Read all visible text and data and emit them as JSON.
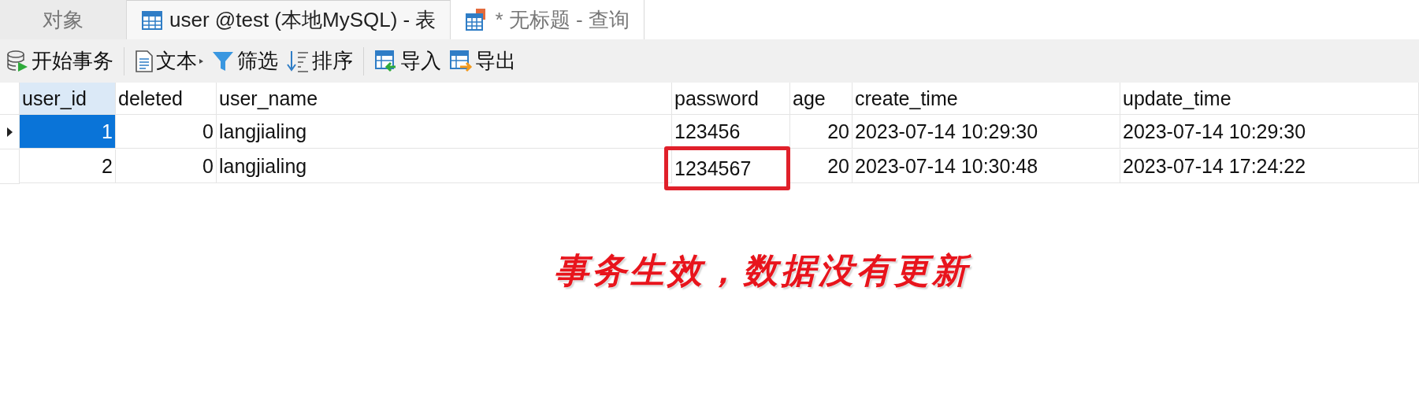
{
  "tabs": [
    {
      "label": "对象",
      "kind": "plain",
      "selected": false
    },
    {
      "label": "user @test (本地MySQL) - 表",
      "kind": "table",
      "selected": true
    },
    {
      "label": "* 无标题 - 查询",
      "kind": "query",
      "selected": false
    }
  ],
  "toolbar": [
    [
      {
        "label": "开始事务",
        "kind": "begin",
        "dropdown": false
      }
    ],
    [
      {
        "label": "文本",
        "kind": "text",
        "dropdown": true
      },
      {
        "label": "筛选",
        "kind": "filter",
        "dropdown": false
      },
      {
        "label": "排序",
        "kind": "sort",
        "dropdown": false
      }
    ],
    [
      {
        "label": "导入",
        "kind": "import",
        "dropdown": false
      },
      {
        "label": "导出",
        "kind": "export",
        "dropdown": false
      }
    ]
  ],
  "table": {
    "columns": [
      {
        "label": "user_id",
        "kind": "number",
        "selected": true
      },
      {
        "label": "deleted",
        "kind": "number",
        "selected": false
      },
      {
        "label": "user_name",
        "kind": "text",
        "selected": false
      },
      {
        "label": "password",
        "kind": "text",
        "selected": false
      },
      {
        "label": "age",
        "kind": "number",
        "selected": false
      },
      {
        "label": "create_time",
        "kind": "text",
        "selected": false
      },
      {
        "label": "update_time",
        "kind": "text",
        "selected": false
      }
    ],
    "rows": [
      {
        "selected": true,
        "cells": [
          {
            "text": "1",
            "outlined": false
          },
          {
            "text": "0",
            "outlined": false
          },
          {
            "text": "langjialing",
            "outlined": false
          },
          {
            "text": "123456",
            "outlined": false
          },
          {
            "text": "20",
            "outlined": false
          },
          {
            "text": "2023-07-14 10:29:30",
            "outlined": false
          },
          {
            "text": "2023-07-14 10:29:30",
            "outlined": false
          }
        ]
      },
      {
        "selected": false,
        "cells": [
          {
            "text": "2",
            "outlined": false
          },
          {
            "text": "0",
            "outlined": false
          },
          {
            "text": "langjialing",
            "outlined": false
          },
          {
            "text": "1234567",
            "outlined": true
          },
          {
            "text": "20",
            "outlined": false
          },
          {
            "text": "2023-07-14 10:30:48",
            "outlined": false
          },
          {
            "text": "2023-07-14 17:24:22",
            "outlined": false
          }
        ]
      }
    ]
  },
  "annotation": {
    "text": "事务生效，数据没有更新"
  }
}
